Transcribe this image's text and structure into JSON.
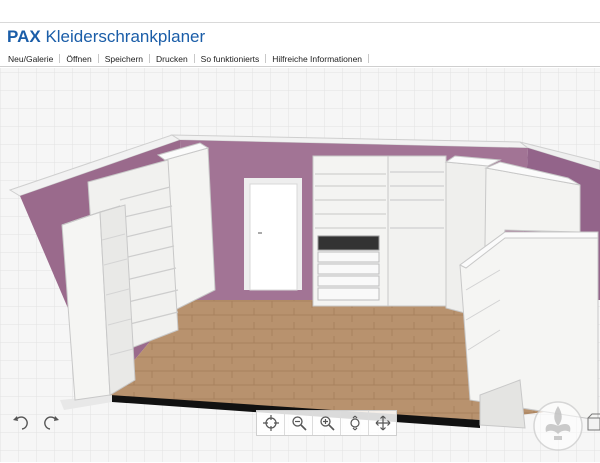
{
  "app": {
    "brand_bold": "PAX",
    "brand_rest": "Kleiderschrankplaner"
  },
  "menu": [
    "Neu/Galerie",
    "Öffnen",
    "Speichern",
    "Drucken",
    "So funktionierts",
    "Hilfreiche Informationen"
  ],
  "toolbar": {
    "buttons": [
      {
        "name": "center-view-button",
        "icon": "crosshair-icon"
      },
      {
        "name": "zoom-out-button",
        "icon": "zoom-out-icon"
      },
      {
        "name": "zoom-in-button",
        "icon": "zoom-in-icon"
      },
      {
        "name": "rotate-view-button",
        "icon": "rotate-icon"
      },
      {
        "name": "pan-view-button",
        "icon": "move-icon"
      }
    ],
    "undo_icon": "undo-icon",
    "redo_icon": "redo-icon"
  },
  "colors": {
    "brand": "#1a5da8",
    "wall": "#9b6a8d",
    "floor": "#b89574",
    "furniture": "#f4f4f2"
  }
}
